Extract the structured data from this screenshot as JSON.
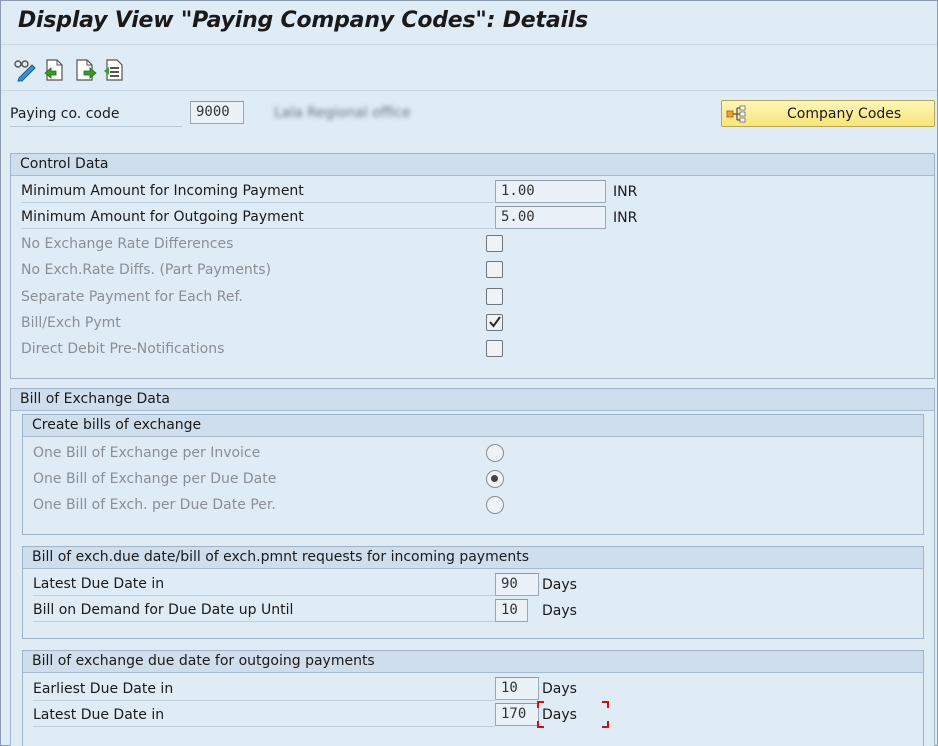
{
  "window": {
    "title": "Display View \"Paying Company Codes\": Details"
  },
  "toolbar": {
    "icons": [
      "display-change-icon",
      "previous-entry-icon",
      "next-entry-icon",
      "variable-list-icon"
    ]
  },
  "header": {
    "paying_code_label": "Paying co. code",
    "paying_code_value": "9000",
    "paying_code_desc": "Lala Regional office",
    "company_codes_button": "Company Codes"
  },
  "control_data": {
    "title": "Control Data",
    "min_incoming_label": "Minimum Amount for Incoming Payment",
    "min_incoming_value": "1.00",
    "min_incoming_unit": "INR",
    "min_outgoing_label": "Minimum Amount for Outgoing Payment",
    "min_outgoing_value": "5.00",
    "min_outgoing_unit": "INR",
    "checkboxes": [
      {
        "label": "No Exchange Rate Differences",
        "checked": false
      },
      {
        "label": "No Exch.Rate Diffs. (Part Payments)",
        "checked": false
      },
      {
        "label": "Separate Payment for Each Ref.",
        "checked": false
      },
      {
        "label": "Bill/Exch Pymt",
        "checked": true
      },
      {
        "label": "Direct Debit Pre-Notifications",
        "checked": false
      }
    ]
  },
  "bill_exchange": {
    "title": "Bill of Exchange Data",
    "create": {
      "title": "Create bills of exchange",
      "options": [
        {
          "label": "One Bill of Exchange per Invoice",
          "selected": false
        },
        {
          "label": "One Bill of Exchange per Due Date",
          "selected": true
        },
        {
          "label": "One Bill of Exch. per Due Date Per.",
          "selected": false
        }
      ]
    },
    "incoming": {
      "title": "Bill of exch.due date/bill of exch.pmnt requests for incoming payments",
      "latest_label": "Latest Due Date in",
      "latest_value": "90",
      "latest_unit": "Days",
      "demand_label": "Bill on Demand for Due Date up Until",
      "demand_value": "10",
      "demand_unit": "Days"
    },
    "outgoing": {
      "title": "Bill of exchange due date for outgoing payments",
      "earliest_label": "Earliest Due Date in",
      "earliest_value": "10",
      "earliest_unit": "Days",
      "latest_label": "Latest Due Date in",
      "latest_value": "170",
      "latest_unit": "Days"
    }
  },
  "colors": {
    "background": "#dfebf5",
    "button": "#f7e57a",
    "focus": "#d01010"
  }
}
